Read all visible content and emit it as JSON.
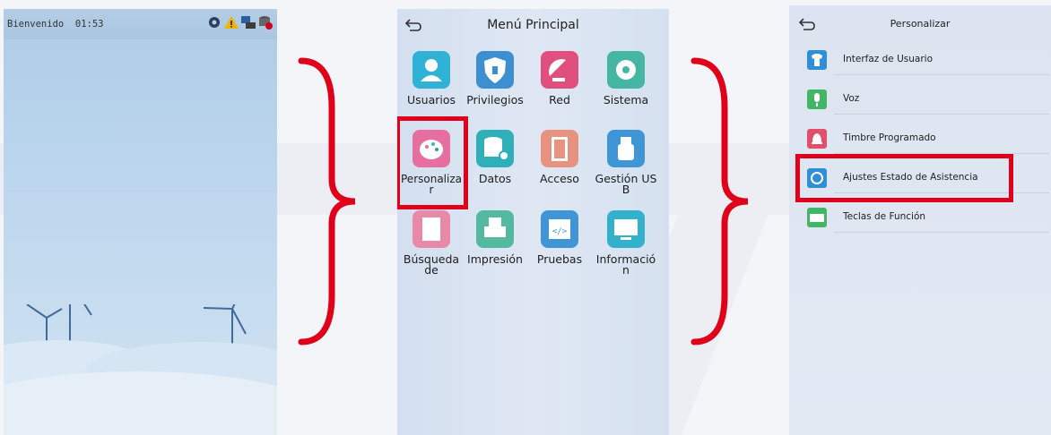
{
  "screen1": {
    "welcome": "Bienvenido",
    "time": "01:53",
    "status_icons": [
      "gear-icon",
      "warning-icon",
      "network-icon",
      "database-icon"
    ]
  },
  "screen2": {
    "title": "Menú Principal",
    "tiles": [
      {
        "label": "Usuarios",
        "icon": "user-icon",
        "color": "#2fb2d6"
      },
      {
        "label": "Privilegios",
        "icon": "shield-icon",
        "color": "#3c8fd0"
      },
      {
        "label": "Red",
        "icon": "satellite-dish-icon",
        "color": "#e0507f"
      },
      {
        "label": "Sistema",
        "icon": "gear-icon",
        "color": "#45b6a3"
      },
      {
        "label": "Personalizar",
        "icon": "palette-icon",
        "color": "#e76fa0"
      },
      {
        "label": "Datos",
        "icon": "database-icon",
        "color": "#2fb0b8"
      },
      {
        "label": "Acceso",
        "icon": "door-icon",
        "color": "#e79380"
      },
      {
        "label": "Gestión USB",
        "icon": "usb-icon",
        "color": "#3f95d6"
      },
      {
        "label": "Búsqueda de",
        "icon": "document-search-icon",
        "color": "#e889a8"
      },
      {
        "label": "Impresión",
        "icon": "printer-icon",
        "color": "#53b9a0"
      },
      {
        "label": "Pruebas",
        "icon": "code-window-icon",
        "color": "#3f95d6"
      },
      {
        "label": "Información",
        "icon": "monitor-icon",
        "color": "#33b0cc"
      }
    ]
  },
  "screen3": {
    "title": "Personalizar",
    "items": [
      {
        "label": "Interfaz de Usuario",
        "icon": "shirt-icon",
        "color": "#2f8fd6"
      },
      {
        "label": "Voz",
        "icon": "microphone-icon",
        "color": "#43b567"
      },
      {
        "label": "Timbre Programado",
        "icon": "bell-icon",
        "color": "#e0506a"
      },
      {
        "label": "Ajustes Estado de Asistencia",
        "icon": "refresh-icon",
        "color": "#2f8fd6"
      },
      {
        "label": "Teclas de Función",
        "icon": "keyboard-icon",
        "color": "#43b567"
      }
    ]
  },
  "colors": {
    "highlight": "#e0001a",
    "brace": "#e0001a"
  }
}
